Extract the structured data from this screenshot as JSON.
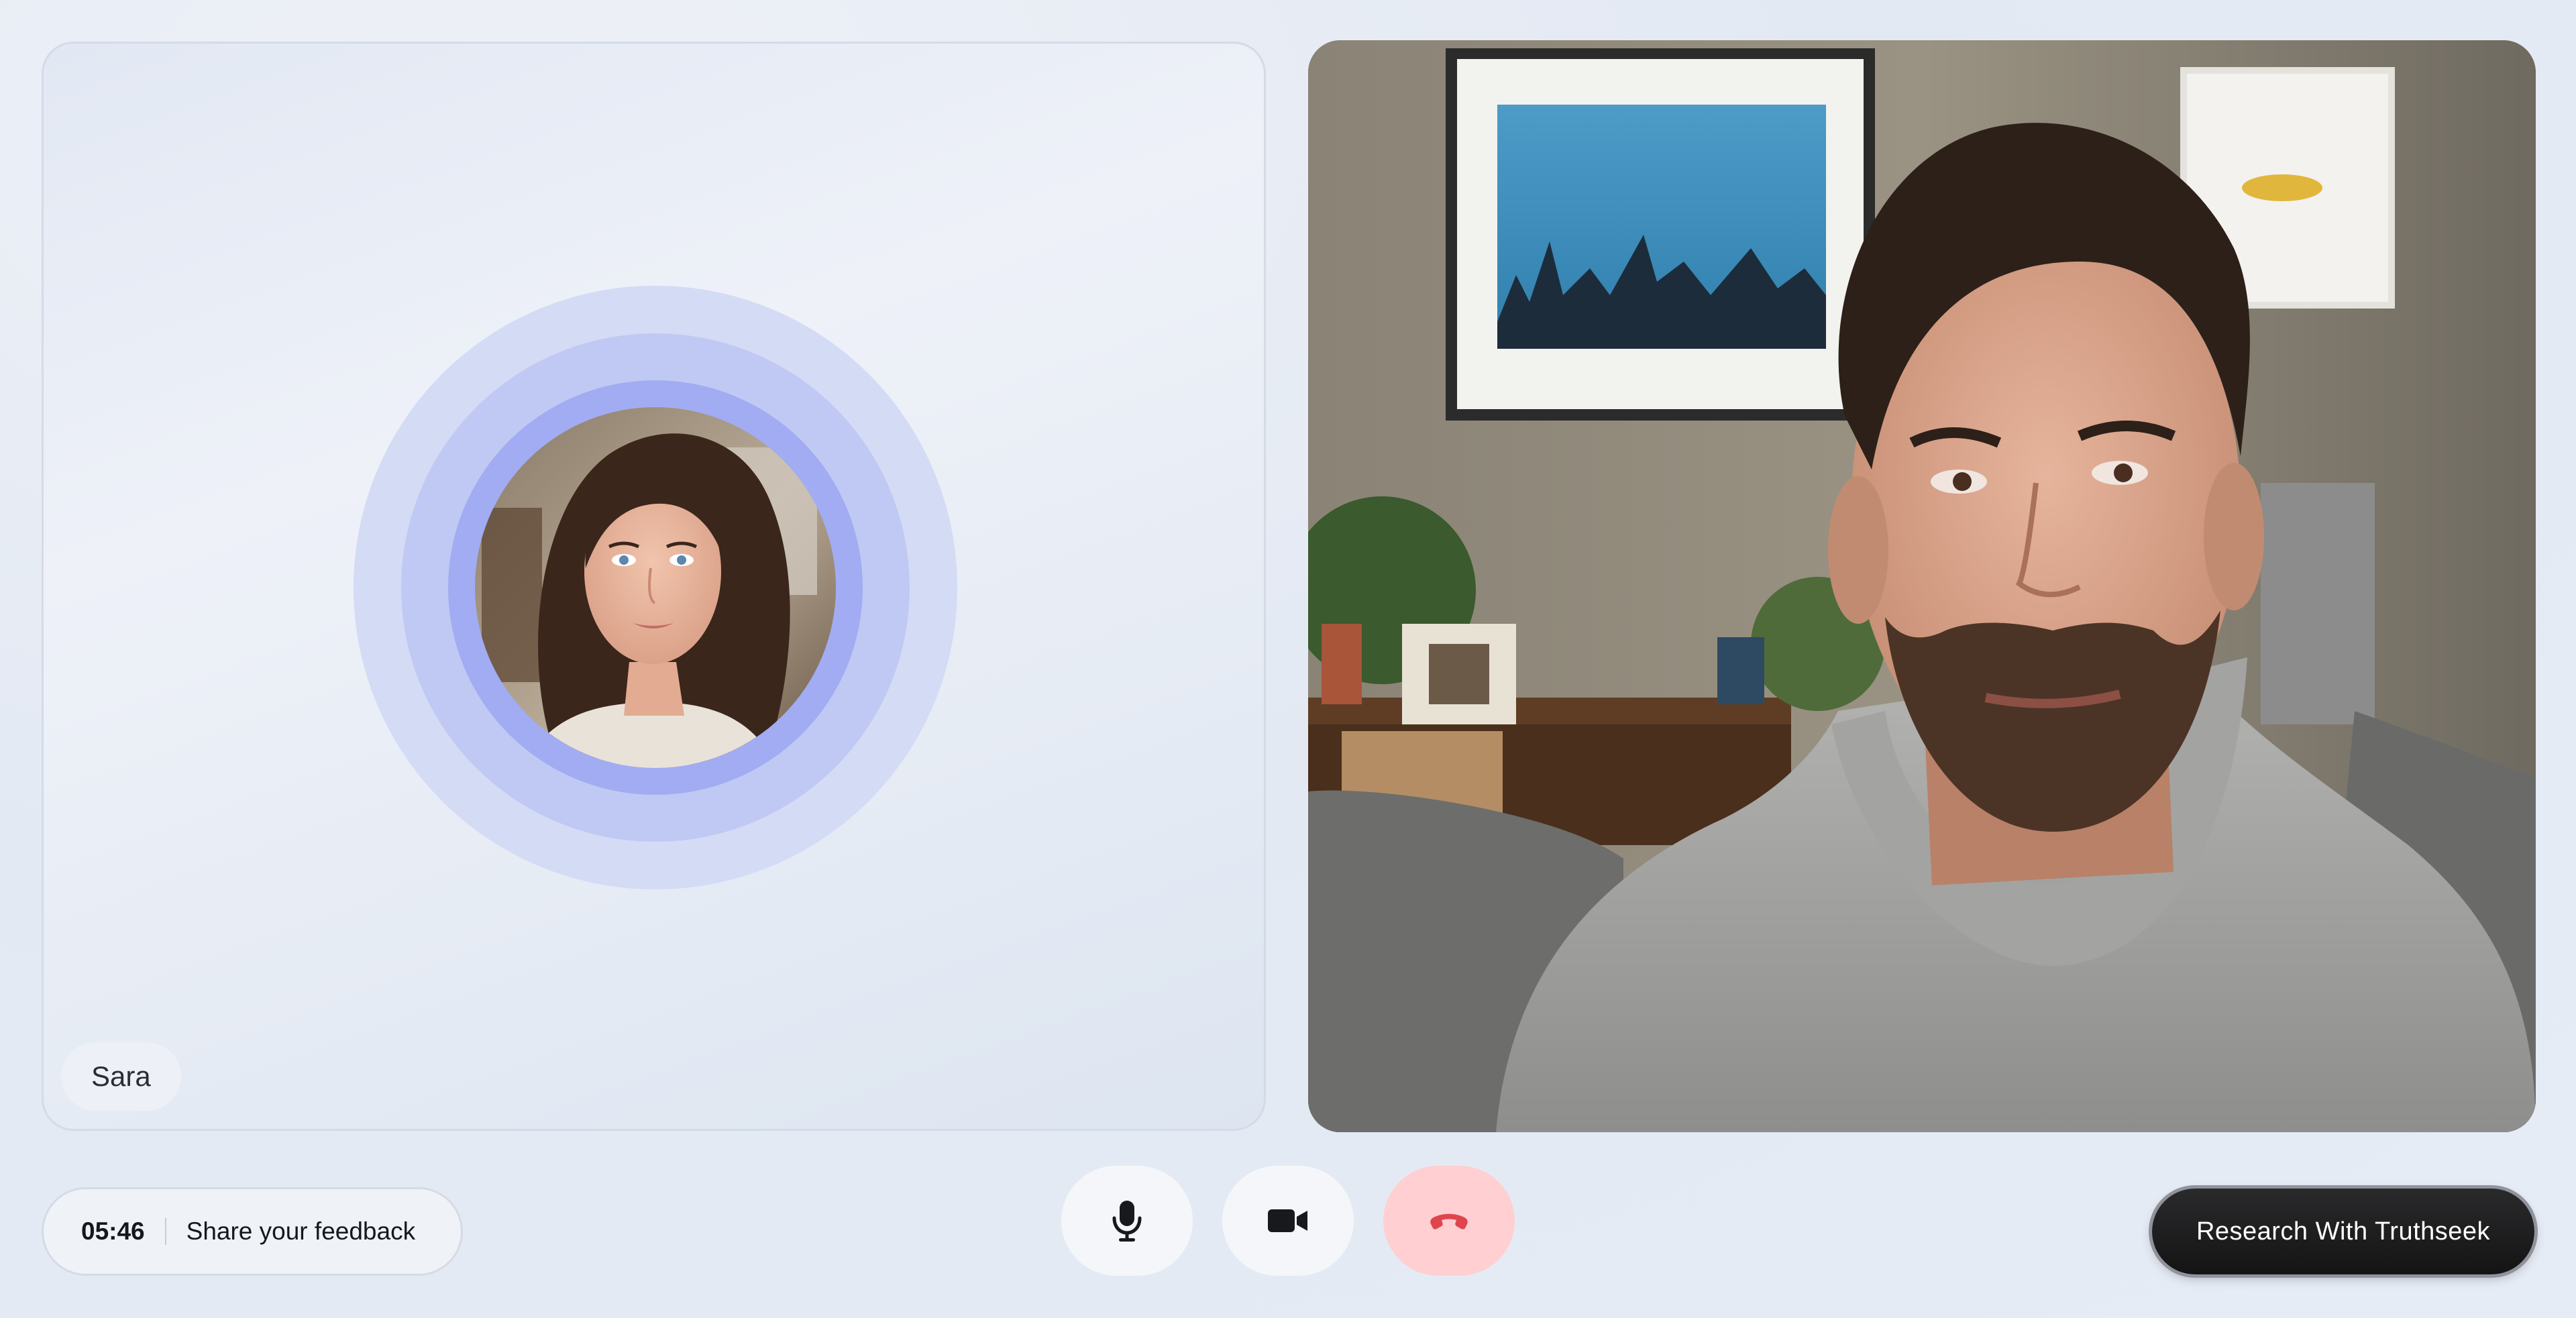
{
  "agent": {
    "name": "Sara",
    "ring_colors": [
      "#d4dbf5",
      "#c0c9f3",
      "#a1acf2"
    ]
  },
  "call": {
    "timer": "05:46",
    "feedback_label": "Share your feedback"
  },
  "controls": {
    "mic_icon": "microphone-icon",
    "camera_icon": "video-camera-icon",
    "end_call_icon": "phone-hangup-icon",
    "end_call_color": "#e0454e"
  },
  "cta": {
    "label": "Research With Truthseek"
  },
  "colors": {
    "accent_ring": "#a1acf2",
    "end_call_bg": "#ffcfd2",
    "cta_bg": "#1a1a1b"
  }
}
